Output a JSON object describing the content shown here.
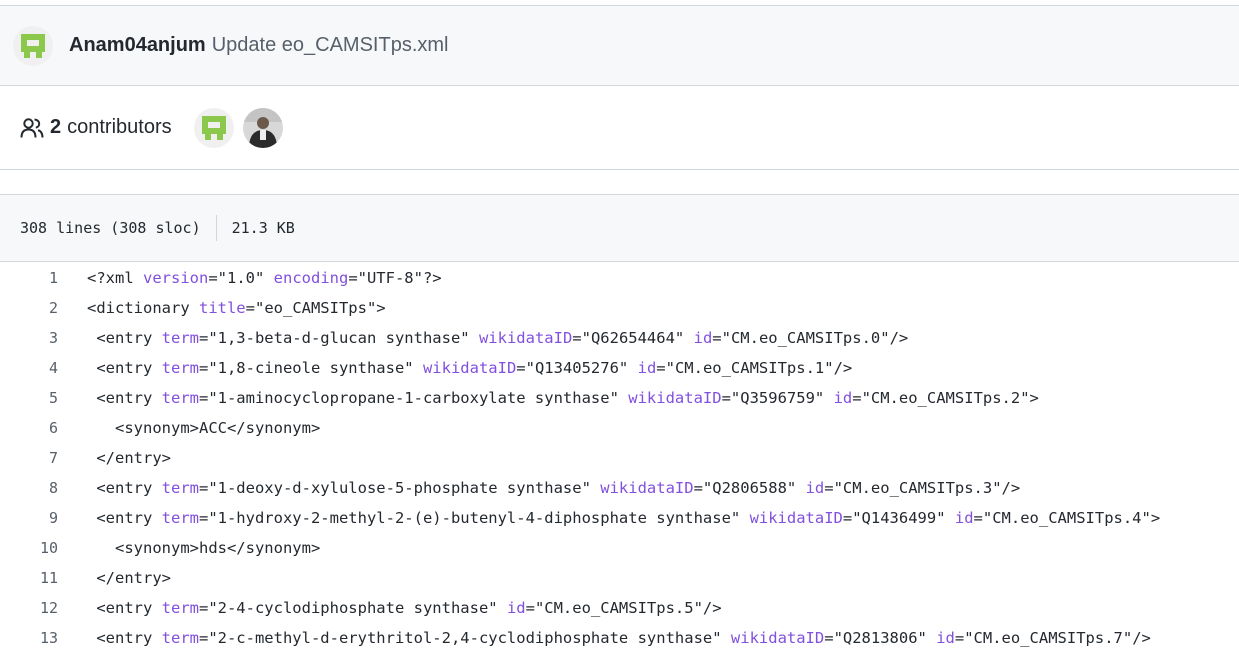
{
  "commit": {
    "author": "Anam04anjum",
    "message": "Update eo_CAMSITps.xml"
  },
  "contributors": {
    "count": "2",
    "label": "contributors"
  },
  "file": {
    "lines": "308 lines (308 sloc)",
    "size": "21.3 KB"
  },
  "code": {
    "line_numbers": [
      "1",
      "2",
      "3",
      "4",
      "5",
      "6",
      "7",
      "8",
      "9",
      "10",
      "11",
      "12",
      "13"
    ],
    "l1": {
      "a": "<?xml ",
      "b": "version",
      "c": "=\"1.0\" ",
      "d": "encoding",
      "e": "=\"UTF-8\"?>"
    },
    "l2": {
      "a": "<dictionary ",
      "b": "title",
      "c": "=\"eo_CAMSITps\">"
    },
    "l3": {
      "a": " <entry ",
      "b": "term",
      "c": "=\"1,3-beta-d-glucan synthase\" ",
      "d": "wikidataID",
      "e": "=\"Q62654464\" ",
      "f": "id",
      "g": "=\"CM.eo_CAMSITps.0\"/>"
    },
    "l4": {
      "a": " <entry ",
      "b": "term",
      "c": "=\"1,8-cineole synthase\" ",
      "d": "wikidataID",
      "e": "=\"Q13405276\" ",
      "f": "id",
      "g": "=\"CM.eo_CAMSITps.1\"/>"
    },
    "l5": {
      "a": " <entry ",
      "b": "term",
      "c": "=\"1-aminocyclopropane-1-carboxylate synthase\" ",
      "d": "wikidataID",
      "e": "=\"Q3596759\" ",
      "f": "id",
      "g": "=\"CM.eo_CAMSITps.2\">"
    },
    "l6": {
      "a": "   <synonym>ACC</synonym>"
    },
    "l7": {
      "a": " </entry>"
    },
    "l8": {
      "a": " <entry ",
      "b": "term",
      "c": "=\"1-deoxy-d-xylulose-5-phosphate synthase\" ",
      "d": "wikidataID",
      "e": "=\"Q2806588\" ",
      "f": "id",
      "g": "=\"CM.eo_CAMSITps.3\"/>"
    },
    "l9": {
      "a": " <entry ",
      "b": "term",
      "c": "=\"1-hydroxy-2-methyl-2-(e)-butenyl-4-diphosphate synthase\" ",
      "d": "wikidataID",
      "e": "=\"Q1436499\" ",
      "f": "id",
      "g": "=\"CM.eo_CAMSITps.4\">"
    },
    "l10": {
      "a": "   <synonym>hds</synonym>"
    },
    "l11": {
      "a": " </entry>"
    },
    "l12": {
      "a": " <entry ",
      "b": "term",
      "c": "=\"2-4-cyclodiphosphate synthase\" ",
      "d": "id",
      "e": "=\"CM.eo_CAMSITps.5\"/>"
    },
    "l13": {
      "a": " <entry ",
      "b": "term",
      "c": "=\"2-c-methyl-d-erythritol-2,4-cyclodiphosphate synthase\" ",
      "d": "wikidataID",
      "e": "=\"Q2813806\" ",
      "f": "id",
      "g": "=\"CM.eo_CAMSITps.7\"/>"
    }
  },
  "colors": {
    "attribute": "#8250df",
    "string": "#0a3069",
    "header_bg": "#f6f8fa",
    "border": "#d0d7de"
  },
  "icons": [
    "identicon-avatar",
    "people-icon",
    "photo-avatar"
  ]
}
